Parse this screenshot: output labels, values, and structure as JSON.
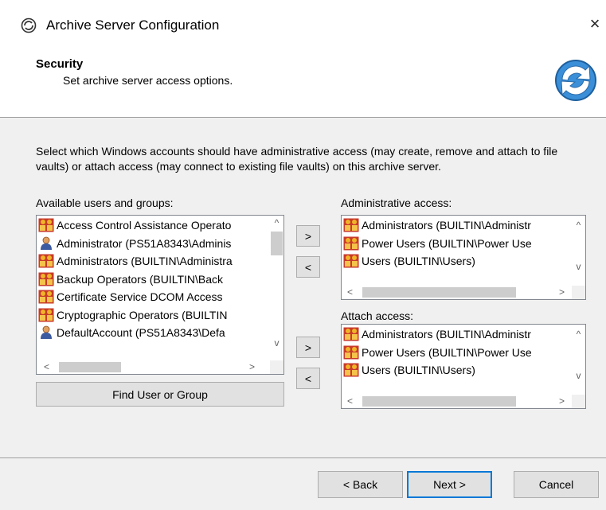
{
  "window": {
    "title": "Archive Server Configuration",
    "close_glyph": "×",
    "app_icon": "archive-server-icon"
  },
  "header": {
    "title": "Security",
    "subtitle": "Set archive server access options.",
    "logo_icon": "refresh-sync-icon"
  },
  "description": "Select which Windows accounts should have administrative access (may create, remove and attach to file vaults) or attach access (may connect to existing file vaults) on this archive server.",
  "available": {
    "label": "Available users and groups:",
    "items": [
      {
        "text": "Access Control Assistance Operato",
        "icon": "group-icon"
      },
      {
        "text": "Administrator (PS51A8343\\Adminis",
        "icon": "user-icon"
      },
      {
        "text": "Administrators (BUILTIN\\Administra",
        "icon": "group-icon"
      },
      {
        "text": "Backup Operators (BUILTIN\\Back",
        "icon": "group-icon"
      },
      {
        "text": "Certificate Service DCOM Access",
        "icon": "group-icon"
      },
      {
        "text": "Cryptographic Operators (BUILTIN",
        "icon": "group-icon"
      },
      {
        "text": "DefaultAccount (PS51A8343\\Defa",
        "icon": "user-icon"
      }
    ],
    "find_button": "Find User or Group"
  },
  "admin": {
    "label": "Administrative access:",
    "items": [
      {
        "text": "Administrators (BUILTIN\\Administr",
        "icon": "group-icon"
      },
      {
        "text": "Power Users (BUILTIN\\Power Use",
        "icon": "group-icon"
      },
      {
        "text": "Users (BUILTIN\\Users)",
        "icon": "group-icon"
      }
    ]
  },
  "attach": {
    "label": "Attach access:",
    "items": [
      {
        "text": "Administrators (BUILTIN\\Administr",
        "icon": "group-icon"
      },
      {
        "text": "Power Users (BUILTIN\\Power Use",
        "icon": "group-icon"
      },
      {
        "text": "Users (BUILTIN\\Users)",
        "icon": "group-icon"
      }
    ]
  },
  "move_buttons": {
    "add": ">",
    "remove": "<"
  },
  "scroll_glyphs": {
    "up": "^",
    "down": "v",
    "left": "<",
    "right": ">"
  },
  "footer": {
    "back": "< Back",
    "next": "Next >",
    "cancel": "Cancel"
  },
  "colors": {
    "accent": "#0078d7",
    "group_icon_red": "#c83a2a",
    "group_icon_yellow": "#f0b428",
    "user_icon_tan": "#e0a060"
  }
}
